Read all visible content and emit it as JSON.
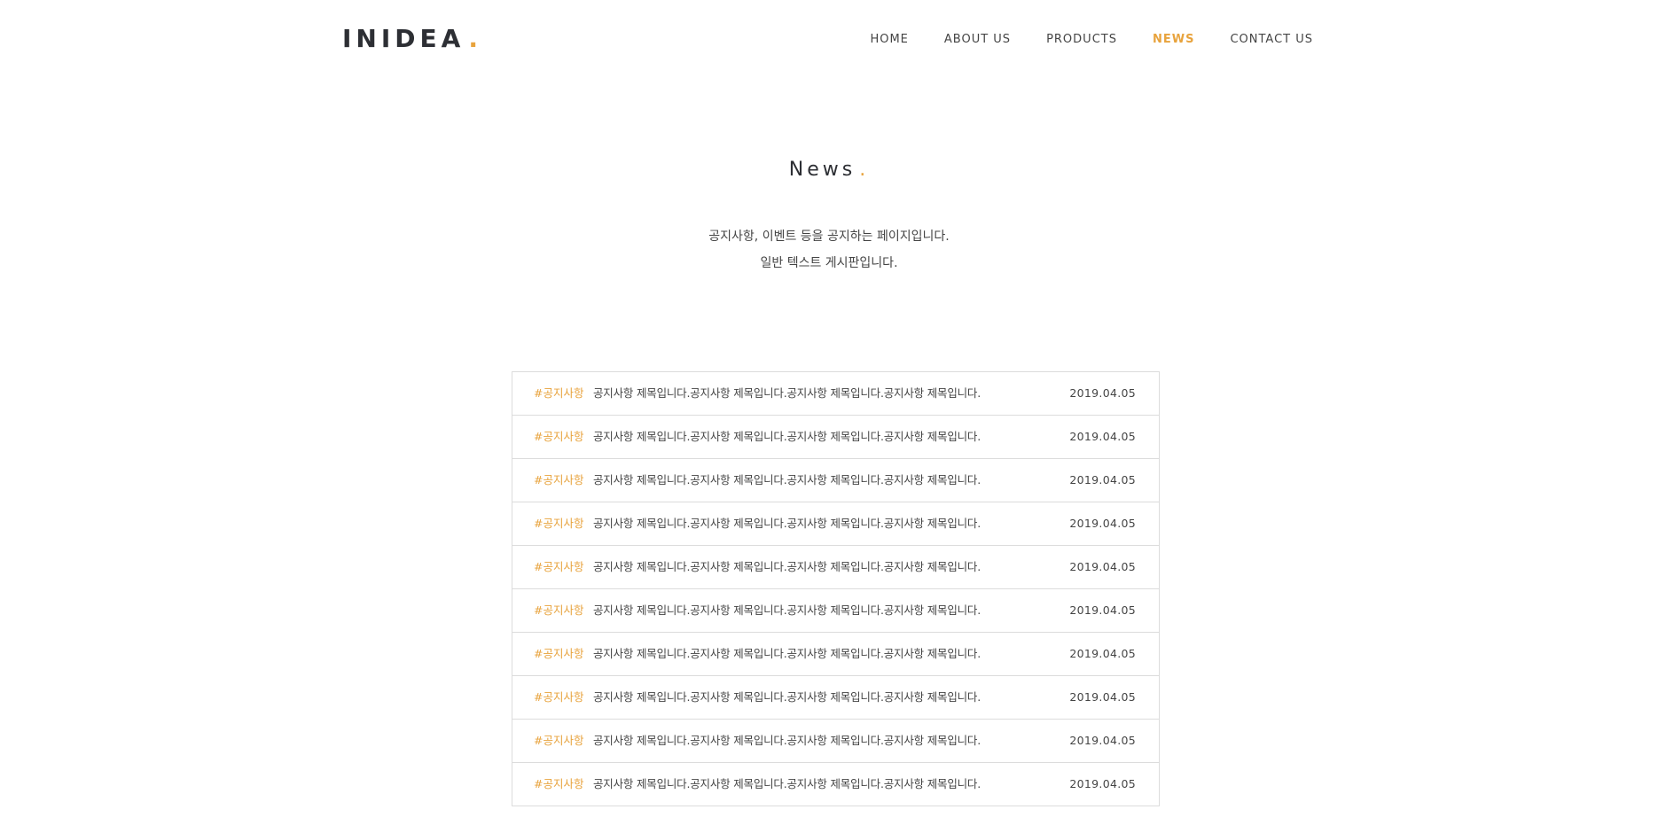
{
  "brand": {
    "name": "INIDEA",
    "dot": ".",
    "accent_color": "#e8a33d"
  },
  "nav": {
    "items": [
      {
        "label": "HOME",
        "active": false
      },
      {
        "label": "ABOUT US",
        "active": false
      },
      {
        "label": "PRODUCTS",
        "active": false
      },
      {
        "label": "NEWS",
        "active": true
      },
      {
        "label": "CONTACT US",
        "active": false
      }
    ]
  },
  "page": {
    "title": "News",
    "title_dot": ".",
    "intro_line1": "공지사항, 이벤트 등을 공지하는 페이지입니다.",
    "intro_line2": "일반 텍스트 게시판입니다."
  },
  "board": {
    "rows": [
      {
        "tag": "#공지사항",
        "title": "공지사항 제목입니다.공지사항 제목입니다.공지사항 제목입니다.공지사항 제목입니다.",
        "date": "2019.04.05"
      },
      {
        "tag": "#공지사항",
        "title": "공지사항 제목입니다.공지사항 제목입니다.공지사항 제목입니다.공지사항 제목입니다.",
        "date": "2019.04.05"
      },
      {
        "tag": "#공지사항",
        "title": "공지사항 제목입니다.공지사항 제목입니다.공지사항 제목입니다.공지사항 제목입니다.",
        "date": "2019.04.05"
      },
      {
        "tag": "#공지사항",
        "title": "공지사항 제목입니다.공지사항 제목입니다.공지사항 제목입니다.공지사항 제목입니다.",
        "date": "2019.04.05"
      },
      {
        "tag": "#공지사항",
        "title": "공지사항 제목입니다.공지사항 제목입니다.공지사항 제목입니다.공지사항 제목입니다.",
        "date": "2019.04.05"
      },
      {
        "tag": "#공지사항",
        "title": "공지사항 제목입니다.공지사항 제목입니다.공지사항 제목입니다.공지사항 제목입니다.",
        "date": "2019.04.05"
      },
      {
        "tag": "#공지사항",
        "title": "공지사항 제목입니다.공지사항 제목입니다.공지사항 제목입니다.공지사항 제목입니다.",
        "date": "2019.04.05"
      },
      {
        "tag": "#공지사항",
        "title": "공지사항 제목입니다.공지사항 제목입니다.공지사항 제목입니다.공지사항 제목입니다.",
        "date": "2019.04.05"
      },
      {
        "tag": "#공지사항",
        "title": "공지사항 제목입니다.공지사항 제목입니다.공지사항 제목입니다.공지사항 제목입니다.",
        "date": "2019.04.05"
      },
      {
        "tag": "#공지사항",
        "title": "공지사항 제목입니다.공지사항 제목입니다.공지사항 제목입니다.공지사항 제목입니다.",
        "date": "2019.04.05"
      }
    ]
  }
}
